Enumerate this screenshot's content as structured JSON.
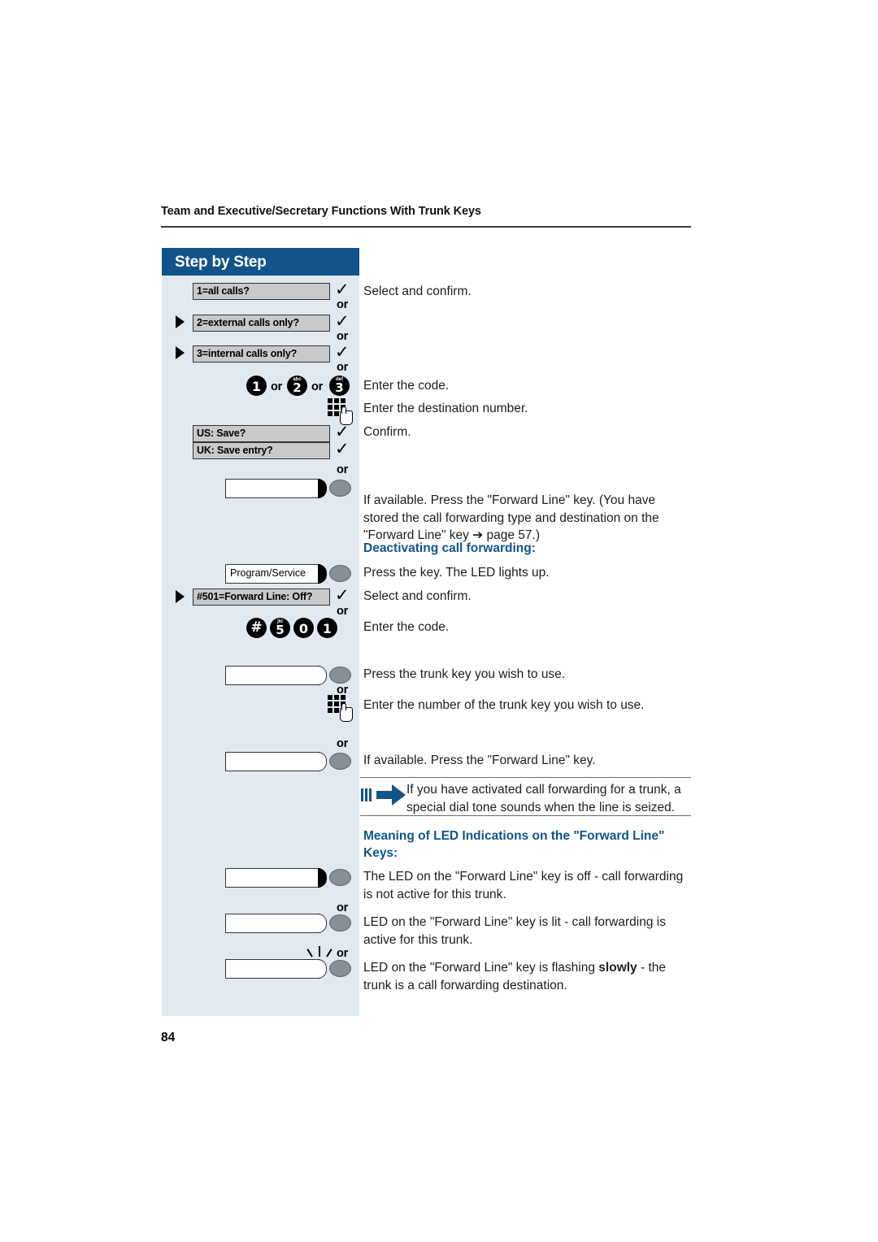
{
  "page": {
    "running_head": "Team and Executive/Secretary Functions With Trunk Keys",
    "folio": "84"
  },
  "sidebar": {
    "title": "Step by Step",
    "display_options": [
      {
        "text": "1=all calls?",
        "marker": false
      },
      {
        "text": "2=external calls only?",
        "marker": true
      },
      {
        "text": "3=internal calls only?",
        "marker": true
      }
    ],
    "save_options": [
      {
        "text": "US: Save?"
      },
      {
        "text": "UK: Save entry?"
      }
    ],
    "program_key_label": "Program/Service",
    "forward_line_option": {
      "text": "#501=Forward Line: Off?",
      "marker": true
    },
    "or_label": "or",
    "confirm_glyph": "✓",
    "keys_code_1": [
      {
        "digit": "1",
        "letters": ""
      },
      {
        "digit": "2",
        "letters": "abc"
      },
      {
        "digit": "3",
        "letters": "def"
      }
    ],
    "keys_code_2": [
      {
        "digit": "#",
        "letters": ""
      },
      {
        "digit": "5",
        "letters": "jkl"
      },
      {
        "digit": "0",
        "letters": ""
      },
      {
        "digit": "1",
        "letters": ""
      }
    ],
    "icons": {
      "dialpad": "dialpad-icon",
      "checkmark": "checkmark-icon",
      "scroll_marker": "left-triangle-icon",
      "note": "blue-arrow-note-icon"
    }
  },
  "main": {
    "lines": {
      "select_confirm_1": "Select and confirm.",
      "enter_code_1": "Enter the code.",
      "enter_destination": "Enter the destination number.",
      "confirm": "Confirm.",
      "forward_line_available": "If available. Press the \"Forward Line\" key. (You have stored the call forwarding type and destination on the \"Forward Line\" key ➔ page 57.)",
      "deactivating_heading": "Deactivating call forwarding:",
      "press_key_led": "Press the key. The LED lights up.",
      "select_confirm_2": "Select and confirm.",
      "enter_code_2": "Enter the code.",
      "press_trunk_key": "Press the trunk key you wish to use.",
      "enter_trunk_number": "Enter the number of the trunk key you wish to use.",
      "forward_line_available_2": "If available. Press the \"Forward Line\" key.",
      "note_text": "If you have activated call forwarding for a trunk, a special dial tone sounds when the line is seized.",
      "led_meaning_heading": "Meaning of LED Indications on the \"Forward Line\" Keys:",
      "led_off": "The LED on the \"Forward Line\" key is off - call forwarding is not active for this trunk.",
      "led_lit": "LED on the \"Forward Line\" key is lit - call forwarding is active for this trunk.",
      "led_flash_pre": "LED on the \"Forward Line\" key is flashing ",
      "led_flash_bold": "slowly",
      "led_flash_post": " - the trunk is a call forwarding destination."
    }
  },
  "colors": {
    "accent_blue": "#12548a",
    "panel_bg": "#e2e8f0",
    "display_gray": "#c9c9c9",
    "key_button_gray": "#898f95"
  }
}
